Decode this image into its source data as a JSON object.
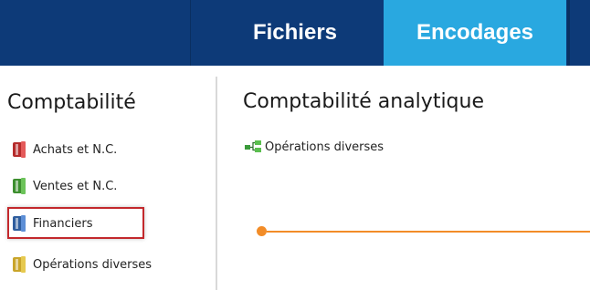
{
  "header": {
    "tabs": [
      {
        "label": "Fichiers"
      },
      {
        "label": "Encodages",
        "active": true
      }
    ],
    "colors": {
      "bar": "#0d3a78",
      "active_tab": "#29a8e0"
    }
  },
  "sidebar": {
    "title": "Comptabilité",
    "items": [
      {
        "label": "Achats et N.C.",
        "icon": "red-ledger-icon"
      },
      {
        "label": "Ventes et N.C.",
        "icon": "green-ledger-icon"
      },
      {
        "label": "Financiers",
        "icon": "blue-ledger-icon",
        "highlighted": true
      },
      {
        "label": "Opérations diverses",
        "icon": "yellow-ledger-icon"
      }
    ]
  },
  "main": {
    "title": "Comptabilité analytique",
    "items": [
      {
        "label": "Opérations diverses",
        "icon": "hierarchy-icon"
      }
    ],
    "timeline_color": "#f28c28"
  }
}
